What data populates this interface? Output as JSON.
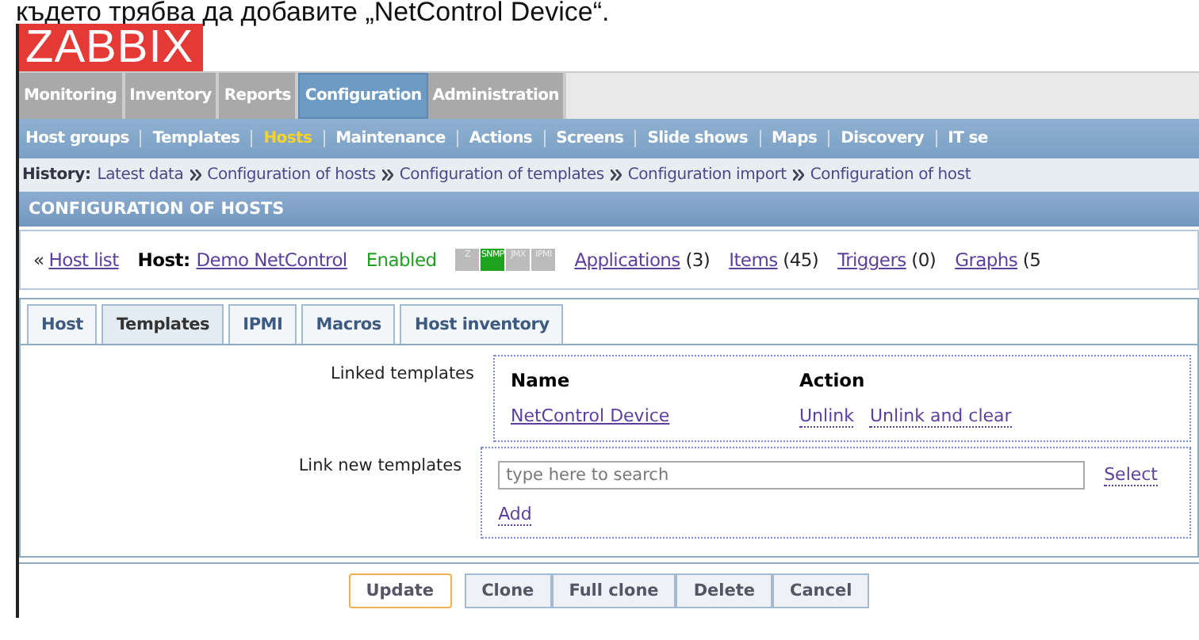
{
  "caption": "където трябва да добавите „NetControl Device“.",
  "logo": "ZABBIX",
  "main_menu": [
    {
      "label": "Monitoring",
      "selected": false
    },
    {
      "label": "Inventory",
      "selected": false
    },
    {
      "label": "Reports",
      "selected": false
    },
    {
      "label": "Configuration",
      "selected": true
    },
    {
      "label": "Administration",
      "selected": false
    }
  ],
  "sub_menu": [
    {
      "label": "Host groups",
      "selected": false
    },
    {
      "label": "Templates",
      "selected": false
    },
    {
      "label": "Hosts",
      "selected": true
    },
    {
      "label": "Maintenance",
      "selected": false
    },
    {
      "label": "Actions",
      "selected": false
    },
    {
      "label": "Screens",
      "selected": false
    },
    {
      "label": "Slide shows",
      "selected": false
    },
    {
      "label": "Maps",
      "selected": false
    },
    {
      "label": "Discovery",
      "selected": false
    },
    {
      "label": "IT se",
      "selected": false
    }
  ],
  "history": {
    "label": "History:",
    "items": [
      "Latest data",
      "Configuration of hosts",
      "Configuration of templates",
      "Configuration import",
      "Configuration of host"
    ]
  },
  "page_title": "CONFIGURATION OF HOSTS",
  "host_bar": {
    "back_marker": "«",
    "back": "Host list",
    "host_label": "Host:",
    "host_name": "Demo NetControl",
    "status": "Enabled",
    "availability": [
      {
        "label": "Z",
        "available": false
      },
      {
        "label": "SNMP",
        "available": true
      },
      {
        "label": "JMX",
        "available": false
      },
      {
        "label": "IPMI",
        "available": false
      }
    ],
    "links": [
      {
        "label": "Applications",
        "count": "(3)"
      },
      {
        "label": "Items",
        "count": "(45)"
      },
      {
        "label": "Triggers",
        "count": "(0)"
      },
      {
        "label": "Graphs",
        "count": "(5"
      }
    ]
  },
  "tabs": [
    {
      "label": "Host",
      "selected": false
    },
    {
      "label": "Templates",
      "selected": true
    },
    {
      "label": "IPMI",
      "selected": false
    },
    {
      "label": "Macros",
      "selected": false
    },
    {
      "label": "Host inventory",
      "selected": false
    }
  ],
  "linked_templates": {
    "label": "Linked templates",
    "columns": [
      "Name",
      "Action"
    ],
    "rows": [
      {
        "name": "NetControl Device",
        "actions": [
          "Unlink",
          "Unlink and clear"
        ]
      }
    ]
  },
  "link_new": {
    "label": "Link new templates",
    "placeholder": "type here to search",
    "select": "Select",
    "add": "Add"
  },
  "buttons": [
    {
      "label": "Update",
      "primary": true
    },
    {
      "label": "Clone",
      "primary": false
    },
    {
      "label": "Full clone",
      "primary": false
    },
    {
      "label": "Delete",
      "primary": false
    },
    {
      "label": "Cancel",
      "primary": false
    }
  ]
}
